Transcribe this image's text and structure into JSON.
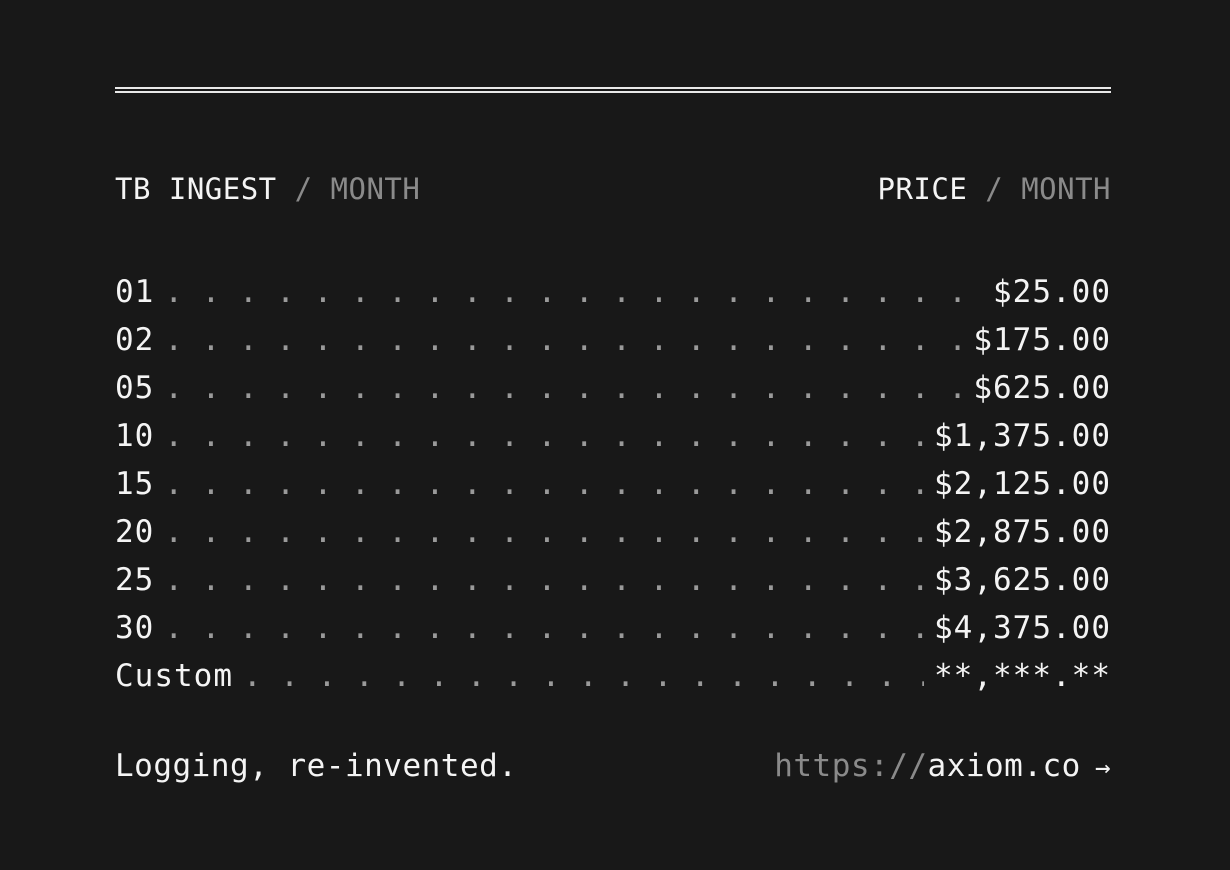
{
  "header": {
    "left_main": "TB INGEST",
    "left_sep": " / ",
    "left_unit": "MONTH",
    "right_main": "PRICE",
    "right_sep": " / ",
    "right_unit": "MONTH"
  },
  "rows": [
    {
      "qty": "01",
      "price": "$25.00"
    },
    {
      "qty": "02",
      "price": "$175.00"
    },
    {
      "qty": "05",
      "price": "$625.00"
    },
    {
      "qty": "10",
      "price": "$1,375.00"
    },
    {
      "qty": "15",
      "price": "$2,125.00"
    },
    {
      "qty": "20",
      "price": "$2,875.00"
    },
    {
      "qty": "25",
      "price": "$3,625.00"
    },
    {
      "qty": "30",
      "price": "$4,375.00"
    },
    {
      "qty": "Custom",
      "price": "**,***.**"
    }
  ],
  "footer": {
    "tagline": "Logging, re-invented.",
    "url_scheme": "https://",
    "url_host": "axiom.co",
    "arrow": "→",
    "arrow_icon": "arrow-right-icon"
  },
  "colors": {
    "background": "#181818",
    "text": "#f4f4f4",
    "muted": "#8a8a8a"
  }
}
